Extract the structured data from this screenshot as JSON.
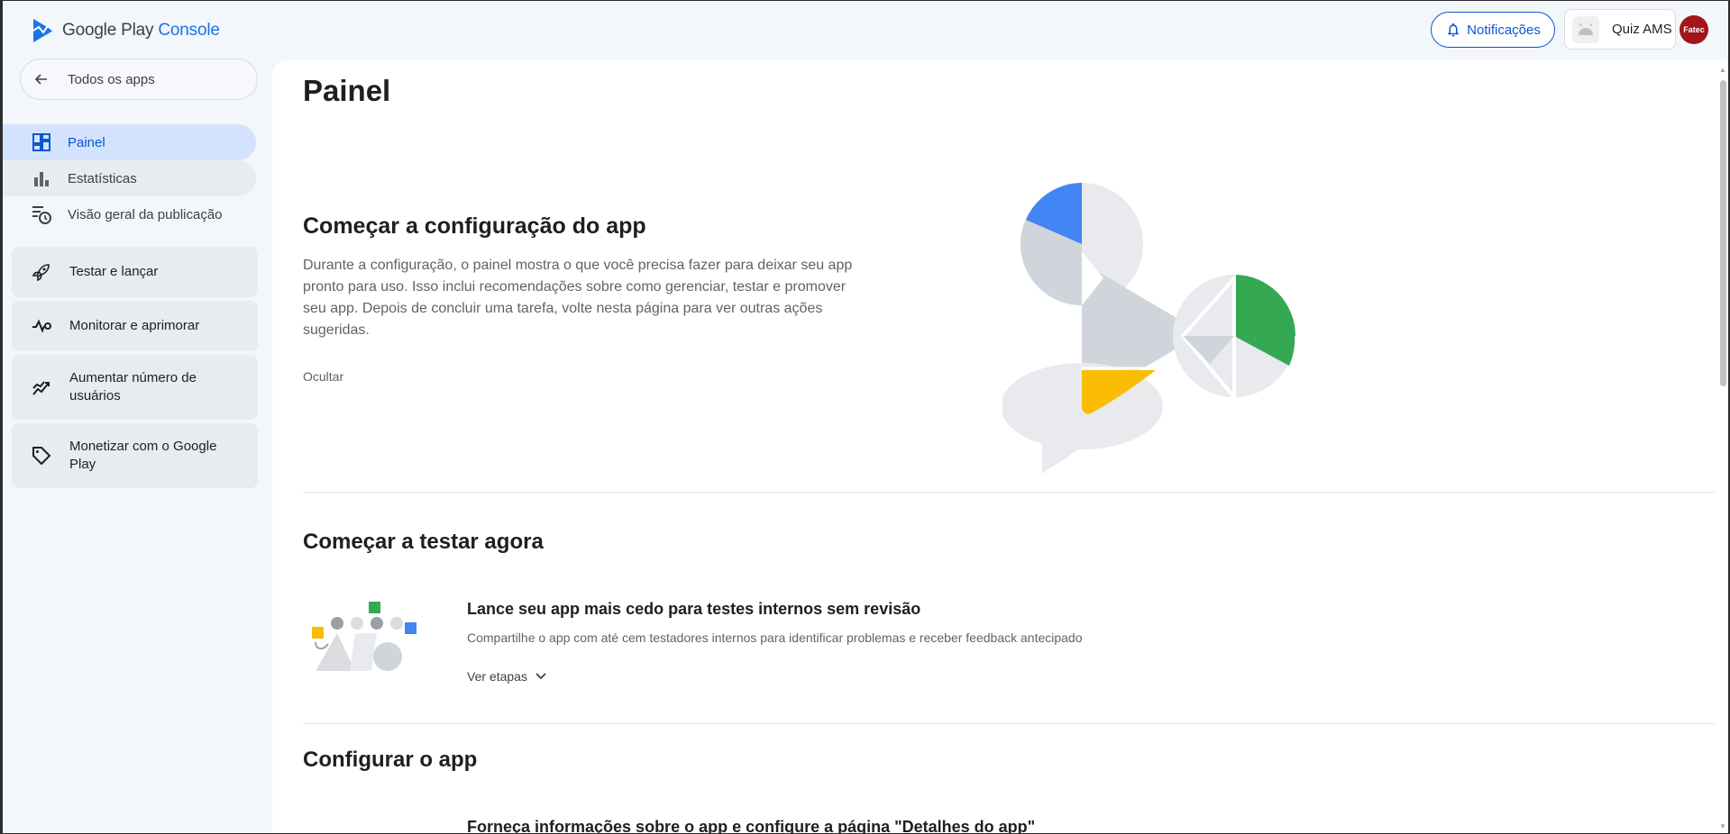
{
  "header": {
    "logo_prefix": "Google Play",
    "logo_suffix": "Console",
    "notifications_label": "Notificações",
    "app_name": "Quiz AMS",
    "avatar_text": "Fatec"
  },
  "sidebar": {
    "back_label": "Todos os apps",
    "items": [
      {
        "label": "Painel",
        "icon": "dashboard-icon"
      },
      {
        "label": "Estatísticas",
        "icon": "bar-chart-icon"
      },
      {
        "label": "Visão geral da publicação",
        "icon": "publishing-overview-icon"
      }
    ],
    "cards": [
      {
        "label": "Testar e lançar",
        "icon": "rocket-icon"
      },
      {
        "label": "Monitorar e aprimorar",
        "icon": "vitals-icon"
      },
      {
        "label": "Aumentar número de usuários",
        "icon": "growth-icon"
      },
      {
        "label": "Monetizar com o Google Play",
        "icon": "tag-icon"
      }
    ]
  },
  "main": {
    "title": "Painel",
    "setup": {
      "title": "Começar a configuração do app",
      "description": "Durante a configuração, o painel mostra o que você precisa fazer para deixar seu app pronto para uso. Isso inclui recomendações sobre como gerenciar, testar e promover seu app. Depois de concluir uma tarefa, volte nesta página para ver outras ações sugeridas.",
      "hide_label": "Ocultar"
    },
    "testing": {
      "title": "Começar a testar agora",
      "card_title": "Lance seu app mais cedo para testes internos sem revisão",
      "card_desc": "Compartilhe o app com até cem testadores internos para identificar problemas e receber feedback antecipado",
      "steps_label": "Ver etapas"
    },
    "configure": {
      "title": "Configurar o app",
      "card_title": "Forneça informações sobre o app e configure a página \"Detalhes do app\""
    }
  },
  "colors": {
    "accent": "#0b57d0",
    "active_nav": "#d3e3fd",
    "blue": "#4285f4",
    "green": "#34a853",
    "yellow": "#fbbc04"
  }
}
